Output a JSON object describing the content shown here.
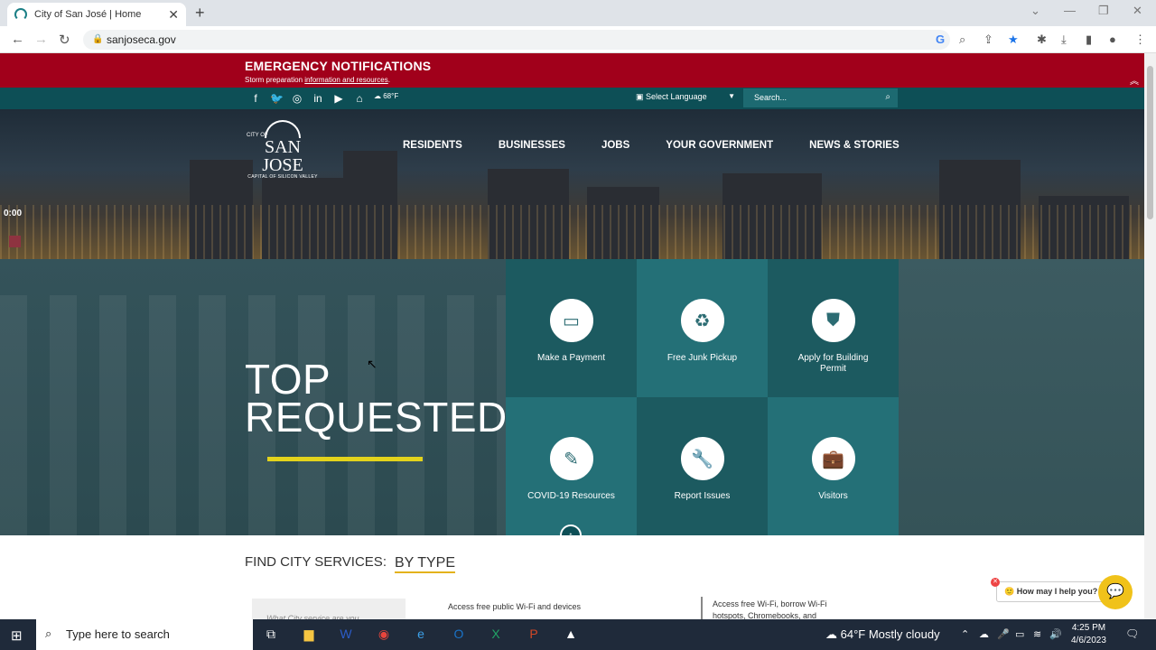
{
  "browser": {
    "tab_title": "City of San José | Home",
    "url": "sanjoseca.gov",
    "window_controls": [
      "⌄",
      "—",
      "❐",
      "✕"
    ]
  },
  "emergency": {
    "title": "EMERGENCY NOTIFICATIONS",
    "text": "Storm preparation ",
    "link": "information and resources",
    "link_suffix": "."
  },
  "utility": {
    "weather": "68°F",
    "language": "Select Language",
    "search_placeholder": "Search..."
  },
  "logo": {
    "city_of": "CITY OF",
    "name": "SAN JOSE",
    "tagline": "CAPITAL OF SILICON VALLEY"
  },
  "nav": [
    "RESIDENTS",
    "BUSINESSES",
    "JOBS",
    "YOUR GOVERNMENT",
    "NEWS & STORIES"
  ],
  "recording": {
    "timer": "0:00"
  },
  "top_requested": {
    "line1": "TOP",
    "line2": "REQUESTED",
    "tiles": [
      {
        "label": "Make a Payment",
        "icon": "credit-card-icon"
      },
      {
        "label": "Free Junk Pickup",
        "icon": "recycle-bin-icon"
      },
      {
        "label": "Apply for Building Permit",
        "icon": "stamp-icon"
      },
      {
        "label": "COVID-19 Resources",
        "icon": "covid-icon"
      },
      {
        "label": "Report Issues",
        "icon": "wrench-icon"
      },
      {
        "label": "Visitors",
        "icon": "suitcase-icon"
      }
    ]
  },
  "find": {
    "label": "FIND CITY SERVICES:",
    "by_type": "BY TYPE",
    "search_placeholder": "What City service are you",
    "service1": "Access free public Wi-Fi and devices",
    "service2_line1": "Access free Wi-Fi, borrow Wi-Fi",
    "service2_line2": "hotspots, Chromebooks, and"
  },
  "chat": {
    "prompt": "How may I help you?"
  },
  "taskbar": {
    "search_placeholder": "Type here to search",
    "weather": "64°F  Mostly cloudy",
    "time": "4:25 PM",
    "date": "4/6/2023"
  },
  "colors": {
    "emergency_red": "#a1001b",
    "teal_dark": "#0d4f56",
    "tile_dark": "#1c5a60",
    "tile_mid": "#247077",
    "accent_yellow": "#e3d31c"
  }
}
